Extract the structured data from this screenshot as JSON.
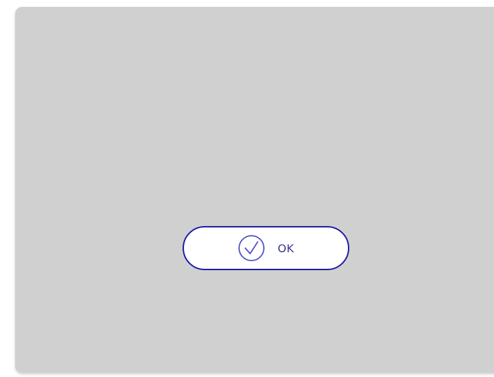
{
  "dialog": {
    "ok_button": {
      "label": "OK",
      "icon": "check-circle-icon"
    }
  },
  "colors": {
    "background": "#ffffff",
    "panel": "#d0d0d0",
    "button_border": "#1c1ca6",
    "icon": "#5050c8",
    "label": "#3a3a88"
  }
}
